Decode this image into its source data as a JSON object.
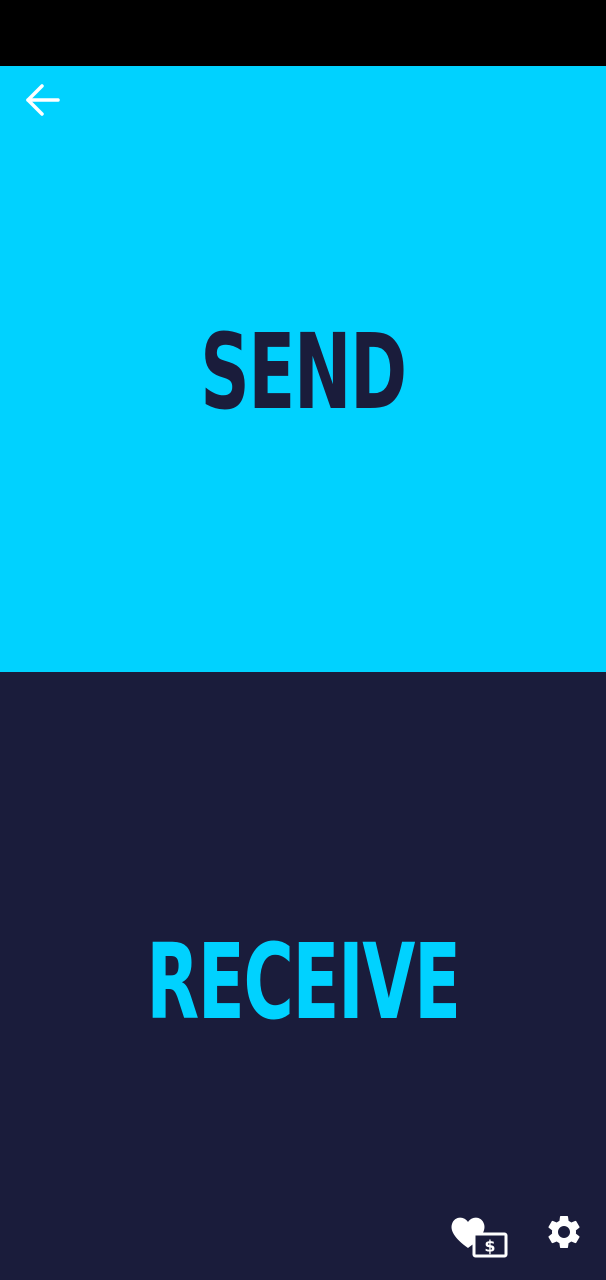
{
  "send_panel": {
    "label": "SEND",
    "background": "#00d2ff",
    "text_color": "#1a1c3b"
  },
  "receive_panel": {
    "label": "RECEIVE",
    "background": "#1a1c3b",
    "text_color": "#00d2ff"
  },
  "icons": {
    "back": "arrow-left-icon",
    "donate": "heart-dollar-icon",
    "settings": "gear-icon"
  }
}
